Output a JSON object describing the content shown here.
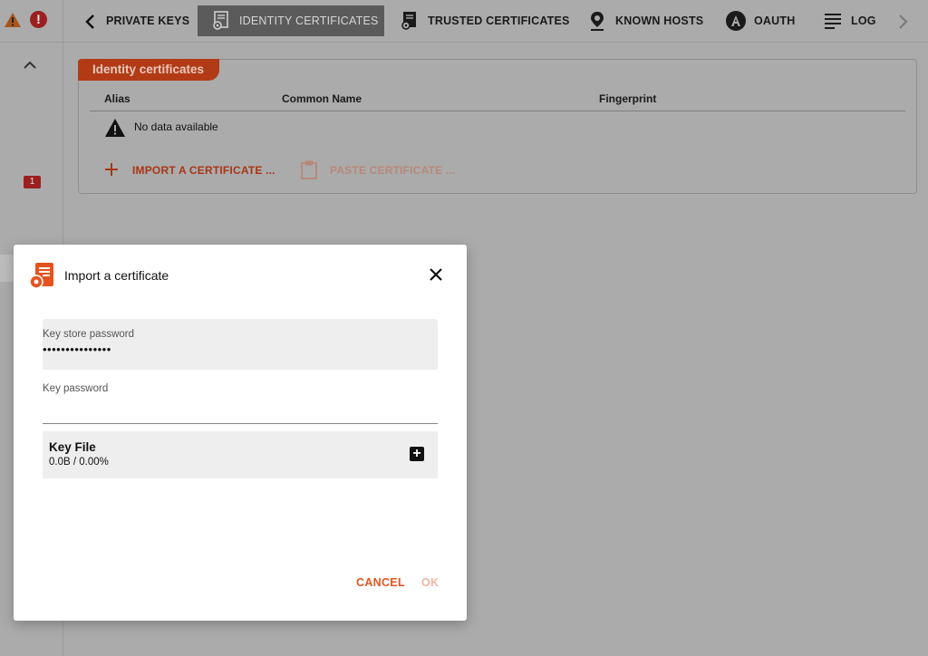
{
  "status": {
    "warning_icon": "warning-triangle-icon",
    "error_icon": "error-circle-icon",
    "error_glyph": "!"
  },
  "tabs": [
    {
      "label": "PRIVATE KEYS",
      "icon": "chevron-left-icon"
    },
    {
      "label": "IDENTITY CERTIFICATES",
      "icon": "certificate-gear-icon",
      "active": true
    },
    {
      "label": "TRUSTED CERTIFICATES",
      "icon": "certificate-gear-icon"
    },
    {
      "label": "KNOWN HOSTS",
      "icon": "map-pin-icon"
    },
    {
      "label": "OAUTH",
      "icon": "oauth-icon"
    },
    {
      "label": "LOG",
      "icon": "lines-icon"
    }
  ],
  "sidebar": {
    "badge_count": "1"
  },
  "panel": {
    "title": "Identity certificates",
    "columns": [
      "Alias",
      "Common Name",
      "Fingerprint"
    ],
    "empty_text": "No data available",
    "import_label": "IMPORT A CERTIFICATE ...",
    "paste_label": "PASTE CERTIFICATE ..."
  },
  "dialog": {
    "title": "Import a certificate",
    "keystore_password": {
      "label": "Key store password",
      "value": "•••••••••••••••"
    },
    "key_password": {
      "label": "Key password",
      "value": ""
    },
    "key_file": {
      "title": "Key File",
      "progress": "0.0B / 0.00%"
    },
    "cancel_label": "CANCEL",
    "ok_label": "OK"
  },
  "colors": {
    "accent": "#e6531f",
    "panel_tag": "#b23b16",
    "badge": "#9c1f1f",
    "overlay": "#ababab"
  }
}
